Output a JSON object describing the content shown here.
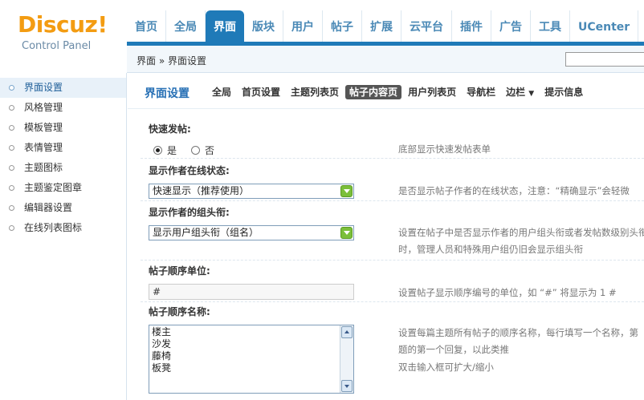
{
  "logo": {
    "main": "Discuz!",
    "sub": "Control Panel"
  },
  "nav": [
    {
      "label": "首页"
    },
    {
      "label": "全局"
    },
    {
      "label": "界面",
      "active": true
    },
    {
      "label": "版块"
    },
    {
      "label": "用户"
    },
    {
      "label": "帖子"
    },
    {
      "label": "扩展"
    },
    {
      "label": "云平台"
    },
    {
      "label": "插件"
    },
    {
      "label": "广告"
    },
    {
      "label": "工具"
    },
    {
      "label": "UCenter"
    }
  ],
  "breadcrumb": "界面 » 界面设置",
  "sidebar": [
    {
      "label": "界面设置",
      "active": true
    },
    {
      "label": "风格管理"
    },
    {
      "label": "模板管理"
    },
    {
      "label": "表情管理"
    },
    {
      "label": "主题图标"
    },
    {
      "label": "主题鉴定图章"
    },
    {
      "label": "编辑器设置"
    },
    {
      "label": "在线列表图标"
    }
  ],
  "subnav": {
    "title": "界面设置",
    "tabs": [
      {
        "label": "全局"
      },
      {
        "label": "首页设置"
      },
      {
        "label": "主题列表页"
      },
      {
        "label": "帖子内容页",
        "active": true
      },
      {
        "label": "用户列表页"
      },
      {
        "label": "导航栏"
      },
      {
        "label": "边栏",
        "caret": "▼"
      },
      {
        "label": "提示信息"
      }
    ]
  },
  "settings": {
    "fastpost": {
      "title": "快速发帖:",
      "yes": "是",
      "no": "否",
      "selected": "yes",
      "desc": "底部显示快速发帖表单"
    },
    "online": {
      "title": "显示作者在线状态:",
      "value": "快速显示（推荐使用）",
      "desc": "是否显示帖子作者的在线状态，注意：“精确显示”会轻微"
    },
    "grouptitle": {
      "title": "显示作者的组头衔:",
      "value": "显示用户组头衔（组名）",
      "desc_line1": "设置在帖子中是否显示作者的用户组头衔或者发帖数级别头衔",
      "desc_line2": "时，管理人员和特殊用户组仍旧会显示组头衔"
    },
    "postno_unit": {
      "title": "帖子顺序单位:",
      "value": "#",
      "desc": "设置帖子显示顺序编号的单位，如 “#” 将显示为  1 #"
    },
    "postno_name": {
      "title": "帖子顺序名称:",
      "lines": [
        "楼主",
        "沙发",
        "藤椅",
        "板凳"
      ],
      "desc_line1": "设置每篇主题所有帖子的顺序名称，每行填写一个名称，第",
      "desc_line2": "题的第一个回复，以此类推",
      "desc_line3": "双击输入框可扩大/缩小"
    }
  }
}
